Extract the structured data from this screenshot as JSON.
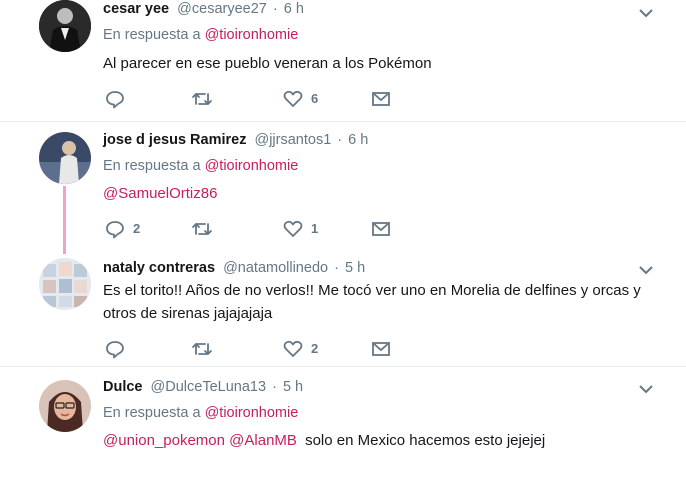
{
  "tweets": [
    {
      "name": "cesar yee",
      "handle": "@cesaryee27",
      "time": "6 h",
      "reply_prefix": "En respuesta a",
      "reply_to": "@tioironhomie",
      "text": "Al parecer en ese pueblo veneran a los Pokémon",
      "replies": "",
      "retweets": "",
      "likes": "6"
    },
    {
      "name": "jose d jesus Ramirez",
      "handle": "@jjrsantos1",
      "time": "6 h",
      "reply_prefix": "En respuesta a",
      "reply_to": "@tioironhomie",
      "mention": "@SamuelOrtiz86",
      "replies": "2",
      "retweets": "",
      "likes": "1"
    },
    {
      "name": "nataly contreras",
      "handle": "@natamollinedo",
      "time": "5 h",
      "text_line1": "Es el torito!! Años de no verlos!! Me tocó ver uno en Morelia de delfines y orcas y",
      "text_line2": "otros de sirenas jajajajaja",
      "replies": "",
      "retweets": "",
      "likes": "2"
    },
    {
      "name": "Dulce",
      "handle": "@DulceTeLuna13",
      "time": "5 h",
      "reply_prefix": "En respuesta a",
      "reply_to": "@tioironhomie",
      "mention1": "@union_pokemon",
      "mention2": "@AlanMB",
      "text": "solo en Mexico hacemos esto jejejej"
    }
  ],
  "separator": "·",
  "colors": {
    "link": "#c81d5f",
    "muted": "#657786",
    "thread": "#f1a3c3",
    "divider": "#e6ecf0"
  }
}
